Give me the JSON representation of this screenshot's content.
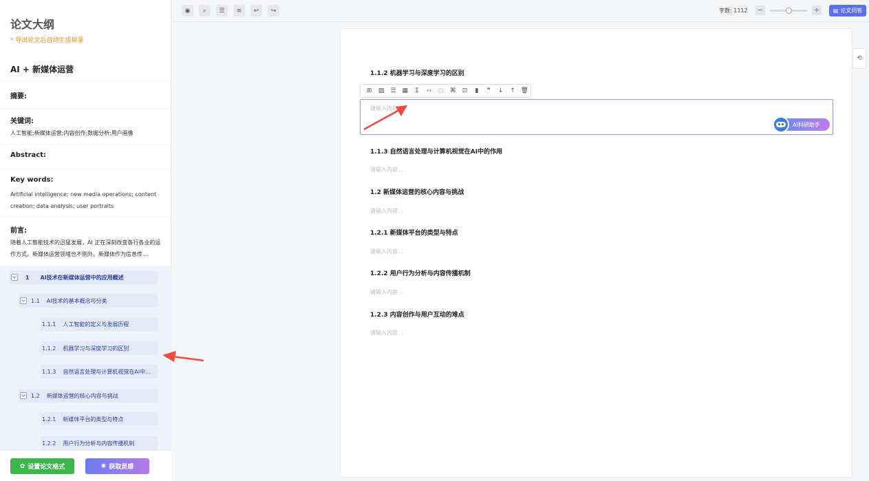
{
  "sidebar": {
    "title": "论文大纲",
    "note": "* 导出论文后自动生成目录",
    "paper_title": "AI + 新媒体运营",
    "sections": [
      {
        "heading": "摘要:",
        "text": ""
      },
      {
        "heading": "关键词:",
        "text": "人工智能;新媒体运营;内容创作;数据分析;用户画像"
      },
      {
        "heading": "Abstract:",
        "text": ""
      },
      {
        "heading": "Key words:",
        "text": "Artificial intelligence; new media operations; content creation; data analysis; user portraits"
      },
      {
        "heading": "前言:",
        "text": "随着人工智能技术的迅猛发展，AI 正在深刻改变各行各业的运作方式，新媒体运营领域也不例外。新媒体作为信息传..."
      }
    ],
    "outline": [
      {
        "num": "1",
        "label": "AI技术在新媒体运营中的应用概述"
      },
      {
        "num": "1.1",
        "label": "AI技术的基本概念与分类"
      },
      {
        "num": "1.1.1",
        "label": "人工智能的定义与发展历程"
      },
      {
        "num": "1.1.2",
        "label": "机器学习与深度学习的区别"
      },
      {
        "num": "1.1.3",
        "label": "自然语言处理与计算机视觉在AI中..."
      },
      {
        "num": "1.2",
        "label": "新媒体运营的核心内容与挑战"
      },
      {
        "num": "1.2.1",
        "label": "新媒体平台的类型与特点"
      },
      {
        "num": "1.2.2",
        "label": "用户行为分析与内容传播机制"
      }
    ],
    "buttons": {
      "format": "设置论文格式",
      "inspiration": "获取灵感"
    }
  },
  "toolbar": {
    "icons": [
      "eye-icon",
      "search-icon",
      "outline-icon",
      "list-icon",
      "undo-icon",
      "redo-icon"
    ],
    "word_count_label": "字数: 1112",
    "zoom_level": 0.5,
    "qa_button": "论文问答"
  },
  "document": {
    "placeholder": "请输入内容...",
    "active_heading": "1.1.2 机器学习与深度学习的区别",
    "editor_tools": [
      "plus-box-icon",
      "image-icon",
      "bullet-list-icon",
      "table-icon",
      "formula-icon",
      "code-icon",
      "bulb-icon",
      "flowchart-icon",
      "reference-icon",
      "bar-chart-icon",
      "quote-icon",
      "arrow-down-icon",
      "arrow-up-icon",
      "trash-icon"
    ],
    "ai_button": "AI科研助手",
    "sections": [
      {
        "heading": "1.1.3 自然语言处理与计算机视觉在AI中的作用"
      },
      {
        "heading": "1.2 新媒体运营的核心内容与挑战"
      },
      {
        "heading": "1.2.1 新媒体平台的类型与特点"
      },
      {
        "heading": "1.2.2 用户行为分析与内容传播机制"
      },
      {
        "heading": "1.2.3 内容创作与用户互动的难点"
      }
    ]
  }
}
